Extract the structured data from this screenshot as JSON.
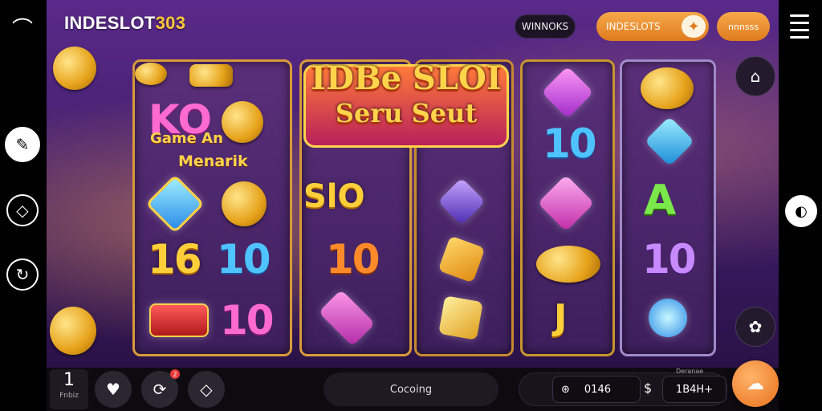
{
  "header": {
    "logo_text": "INDESLOT",
    "logo_num": "303",
    "pill_dark": "WINNOKS",
    "pill_orange": "INDESLOTS",
    "pill_orange2": "nnnsss"
  },
  "reels": {
    "banner_line1": "IDBe SLOI",
    "banner_line2": "Seru Seut",
    "game_label": "KO",
    "game_sub": "Game An",
    "menarik": "Menarik",
    "slot_label": "SlO",
    "r1": [
      "16",
      "10",
      "10"
    ],
    "r2": [
      "10"
    ],
    "r4": [
      "10",
      "J"
    ],
    "r5": [
      "A",
      "10"
    ]
  },
  "bottom": {
    "bet_value": "1",
    "bet_label": "Fnbiz",
    "badge": "2",
    "status": "Cocoing",
    "credit_value": "0146",
    "win_label": "Deranae",
    "win_value": "1B4H+"
  },
  "icons": {
    "heart": "♥",
    "spin": "⟳"
  }
}
